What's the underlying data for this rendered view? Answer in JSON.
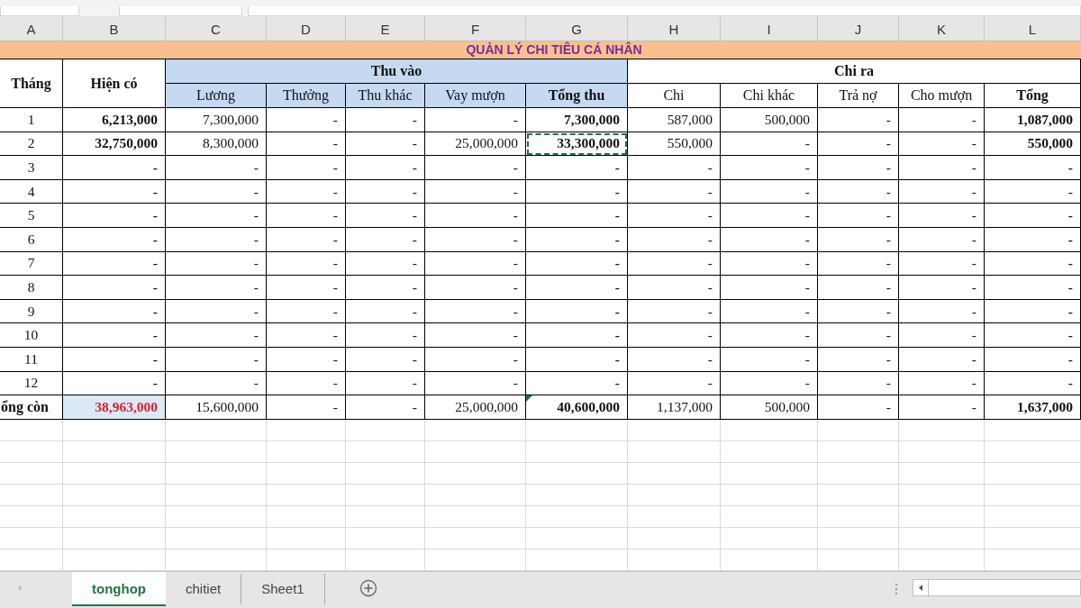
{
  "columns": [
    "A",
    "B",
    "C",
    "D",
    "E",
    "F",
    "G",
    "H",
    "I",
    "J",
    "K",
    "L"
  ],
  "title": "QUẢN LÝ CHI TIÊU CÁ NHÂN",
  "header": {
    "month": "Tháng",
    "balance": "Hiện có",
    "income_group": "Thu vào",
    "expense_group": "Chi ra",
    "income": [
      "Lương",
      "Thưởng",
      "Thu khác",
      "Vay mượn",
      "Tổng thu"
    ],
    "expense": [
      "Chi",
      "Chi khác",
      "Trả nợ",
      "Cho mượn",
      "Tổng"
    ]
  },
  "rows": [
    {
      "month": "1",
      "values": [
        "6,213,000",
        "7,300,000",
        "-",
        "-",
        "-",
        "7,300,000",
        "587,000",
        "500,000",
        "-",
        "-",
        "1,087,000"
      ],
      "marquee": false
    },
    {
      "month": "2",
      "values": [
        "32,750,000",
        "8,300,000",
        "-",
        "-",
        "25,000,000",
        "33,300,000",
        "550,000",
        "-",
        "-",
        "-",
        "550,000"
      ],
      "marquee": true
    },
    {
      "month": "3",
      "values": [
        "-",
        "-",
        "-",
        "-",
        "-",
        "-",
        "-",
        "-",
        "-",
        "-",
        "-"
      ],
      "marquee": false
    },
    {
      "month": "4",
      "values": [
        "-",
        "-",
        "-",
        "-",
        "-",
        "-",
        "-",
        "-",
        "-",
        "-",
        "-"
      ],
      "marquee": false
    },
    {
      "month": "5",
      "values": [
        "-",
        "-",
        "-",
        "-",
        "-",
        "-",
        "-",
        "-",
        "-",
        "-",
        "-"
      ],
      "marquee": false
    },
    {
      "month": "6",
      "values": [
        "-",
        "-",
        "-",
        "-",
        "-",
        "-",
        "-",
        "-",
        "-",
        "-",
        "-"
      ],
      "marquee": false
    },
    {
      "month": "7",
      "values": [
        "-",
        "-",
        "-",
        "-",
        "-",
        "-",
        "-",
        "-",
        "-",
        "-",
        "-"
      ],
      "marquee": false
    },
    {
      "month": "8",
      "values": [
        "-",
        "-",
        "-",
        "-",
        "-",
        "-",
        "-",
        "-",
        "-",
        "-",
        "-"
      ],
      "marquee": false
    },
    {
      "month": "9",
      "values": [
        "-",
        "-",
        "-",
        "-",
        "-",
        "-",
        "-",
        "-",
        "-",
        "-",
        "-"
      ],
      "marquee": false
    },
    {
      "month": "10",
      "values": [
        "-",
        "-",
        "-",
        "-",
        "-",
        "-",
        "-",
        "-",
        "-",
        "-",
        "-"
      ],
      "marquee": false
    },
    {
      "month": "11",
      "values": [
        "-",
        "-",
        "-",
        "-",
        "-",
        "-",
        "-",
        "-",
        "-",
        "-",
        "-"
      ],
      "marquee": false
    },
    {
      "month": "12",
      "values": [
        "-",
        "-",
        "-",
        "-",
        "-",
        "-",
        "-",
        "-",
        "-",
        "-",
        "-"
      ],
      "marquee": false
    }
  ],
  "total": {
    "label": "ổng còn",
    "values": [
      "38,963,000",
      "15,600,000",
      "-",
      "-",
      "25,000,000",
      "40,600,000",
      "1,137,000",
      "500,000",
      "-",
      "-",
      "1,637,000"
    ],
    "flagged": true
  },
  "sheet_tabs": [
    {
      "label": "tonghop",
      "selected": true
    },
    {
      "label": "chitiet",
      "selected": false
    },
    {
      "label": "Sheet1",
      "selected": false
    }
  ]
}
